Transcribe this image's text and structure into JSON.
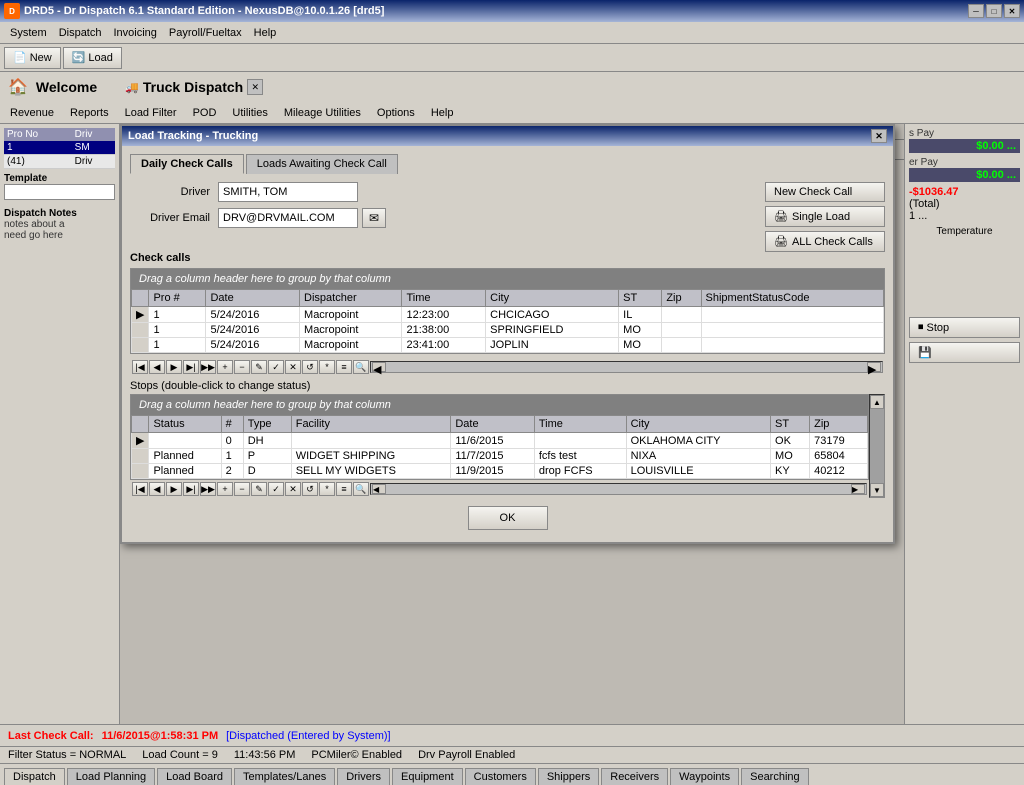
{
  "titleBar": {
    "title": "DRD5 - Dr Dispatch 6.1 Standard Edition - NexusDB@10.0.1.26 [drd5]",
    "iconLabel": "D"
  },
  "mainMenu": {
    "items": [
      "System",
      "Dispatch",
      "Invoicing",
      "Payroll/Fueltax",
      "Help"
    ]
  },
  "toolbar": {
    "newLabel": "New",
    "loadLabel": "Load"
  },
  "welcomeBar": {
    "title": "Welcome",
    "windowTitle": "Truck Dispatch"
  },
  "subMenu": {
    "items": [
      "Revenue",
      "Reports",
      "Load Filter",
      "POD",
      "Utilities",
      "Mileage Utilities",
      "Options",
      "Help"
    ]
  },
  "leftPanel": {
    "tableHeaders": [
      "Pro No",
      "Driv"
    ],
    "rows": [
      {
        "proNo": "1",
        "driver": "SM",
        "selected": true
      }
    ],
    "dispatchNotes": {
      "label": "Dispatch Notes",
      "text": "notes about a\nneed go here"
    },
    "template": {
      "label": "Template"
    }
  },
  "modal": {
    "title": "Load Tracking - Trucking",
    "tabs": [
      {
        "label": "Daily Check Calls",
        "active": true
      },
      {
        "label": "Loads Awaiting Check Call",
        "active": false
      }
    ],
    "driverLabel": "Driver",
    "driverValue": "SMITH, TOM",
    "driverEmailLabel": "Driver Email",
    "driverEmailValue": "DRV@DRVMAIL.COM",
    "buttons": {
      "newCheckCall": "New Check Call",
      "singleLoad": "Single Load",
      "allCheckCalls": "ALL Check Calls"
    },
    "checkCallsLabel": "Check calls",
    "gridHeader": "Drag a column header here to group by that column",
    "checkCallColumns": [
      "Pro #",
      "Date",
      "Dispatcher",
      "Time",
      "City",
      "ST",
      "Zip",
      "ShipmentStatusCode"
    ],
    "checkCallRows": [
      {
        "indicator": "▶",
        "pro": "1",
        "date": "5/24/2016",
        "dispatcher": "Macropoint",
        "time": "12:23:00",
        "city": "CHCICAGO",
        "st": "IL",
        "zip": "",
        "status": ""
      },
      {
        "indicator": "",
        "pro": "1",
        "date": "5/24/2016",
        "dispatcher": "Macropoint",
        "time": "21:38:00",
        "city": "SPRINGFIELD",
        "st": "MO",
        "zip": "",
        "status": ""
      },
      {
        "indicator": "",
        "pro": "1",
        "date": "5/24/2016",
        "dispatcher": "Macropoint",
        "time": "23:41:00",
        "city": "JOPLIN",
        "st": "MO",
        "zip": "",
        "status": ""
      }
    ],
    "stopsLabel": "Stops (double-click to change status)",
    "stopColumns": [
      "Status",
      "#",
      "Type",
      "Facility",
      "Date",
      "Time",
      "City",
      "ST",
      "Zip"
    ],
    "stopRows": [
      {
        "indicator": "▶",
        "status": "",
        "num": "0",
        "type": "DH",
        "facility": "",
        "date": "11/6/2015",
        "time": "",
        "city": "OKLAHOMA CITY",
        "st": "OK",
        "zip": "73179"
      },
      {
        "indicator": "",
        "status": "Planned",
        "num": "1",
        "type": "P",
        "facility": "WIDGET SHIPPING",
        "date": "11/7/2015",
        "time": "fcfs test",
        "city": "NIXA",
        "st": "MO",
        "zip": "65804"
      },
      {
        "indicator": "",
        "status": "Planned",
        "num": "2",
        "type": "D",
        "facility": "SELL MY WIDGETS",
        "date": "11/9/2015",
        "time": "drop FCFS",
        "city": "LOUISVILLE",
        "st": "KY",
        "zip": "40212"
      }
    ],
    "okButton": "OK"
  },
  "rightPanel": {
    "payLabel": "s Pay",
    "payValue": "$0.00",
    "erPayLabel": "er Pay",
    "erPayValue": "$0.00",
    "totalLabel": "(Total)",
    "totalValue": "-$1036.47",
    "totalCount": "1 ...",
    "temperatureLabel": "Temperature",
    "stopButton": "Stop"
  },
  "statusBar": {
    "lastCheckCallLabel": "Last Check Call:",
    "lastCheckCallValue": "11/6/2015@1:58:31 PM",
    "dispatchedText": "[Dispatched (Entered by System)]"
  },
  "loadCountBar": {
    "filterStatus": "Filter Status = NORMAL",
    "loadCount": "Load Count = 9",
    "time": "11:43:56 PM",
    "pcMiler": "PCMiler© Enabled",
    "drvPayroll": "Drv Payroll Enabled"
  },
  "bottomTabs": {
    "items": [
      "Dispatch",
      "Load Planning",
      "Load Board",
      "Templates/Lanes",
      "Drivers",
      "Equipment",
      "Customers",
      "Shippers",
      "Receivers",
      "Waypoints",
      "Searching"
    ],
    "active": "Dispatch"
  }
}
